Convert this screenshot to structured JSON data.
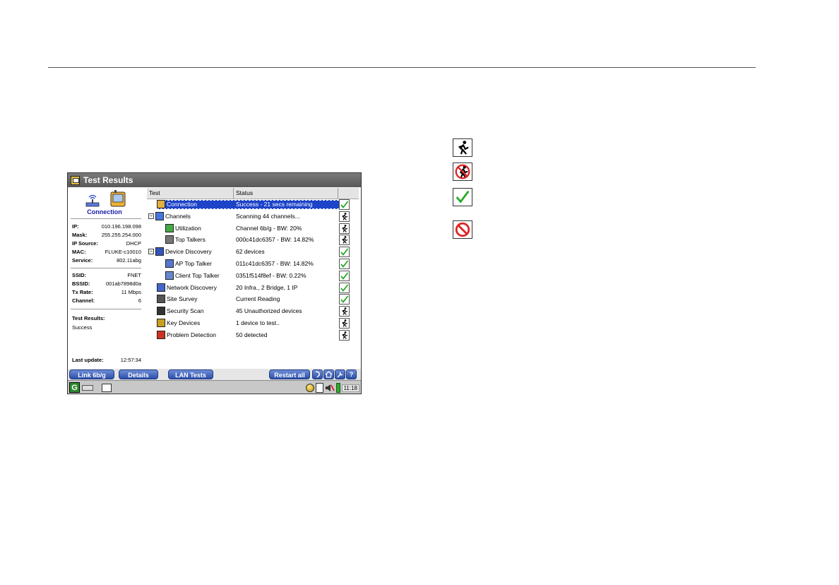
{
  "window": {
    "title": "Test Results"
  },
  "left_panel": {
    "connection_label": "Connection",
    "network_info": [
      {
        "key": "IP:",
        "value": "010.196.198.098"
      },
      {
        "key": "Mask:",
        "value": "255.255.254.000"
      },
      {
        "key": "IP Source:",
        "value": "DHCP"
      },
      {
        "key": "MAC:",
        "value": "FLUKE-c10010"
      },
      {
        "key": "Service:",
        "value": "802.11abg"
      }
    ],
    "wifi_info": [
      {
        "key": "SSID:",
        "value": "FNET"
      },
      {
        "key": "BSSID:",
        "value": "001ab7898d0a"
      },
      {
        "key": "Tx Rate:",
        "value": "11 Mbps"
      },
      {
        "key": "Channel:",
        "value": "6"
      }
    ],
    "test_results_label": "Test Results:",
    "test_results_value": "Success",
    "last_update_label": "Last update:",
    "last_update_value": "12:57:34"
  },
  "table": {
    "col_test": "Test",
    "col_status": "Status",
    "rows": [
      {
        "name": "Connection",
        "status": "Success - 21 secs remaining",
        "result": "check",
        "level": 1,
        "icon": "connection-icon",
        "selected": true
      },
      {
        "name": "Channels",
        "status": "Scanning 44 channels...",
        "result": "run",
        "level": 0,
        "icon": "channels-icon",
        "expander": "−"
      },
      {
        "name": "Utilization",
        "status": "Channel 6b/g - BW: 20%",
        "result": "run",
        "level": 2,
        "icon": "utilization-icon"
      },
      {
        "name": "Top Talkers",
        "status": "000c41dc6357 - BW: 14.82%",
        "result": "run",
        "level": 2,
        "icon": "top-talkers-icon"
      },
      {
        "name": "Device Discovery",
        "status": "62 devices",
        "result": "check",
        "level": 0,
        "icon": "device-discovery-icon",
        "expander": "−"
      },
      {
        "name": "AP Top Talker",
        "status": "011c41dc6357 - BW: 14.82%",
        "result": "check",
        "level": 2,
        "icon": "ap-icon"
      },
      {
        "name": "Client Top Talker",
        "status": "0351f514f8ef - BW: 0.22%",
        "result": "check",
        "level": 2,
        "icon": "client-icon"
      },
      {
        "name": "Network Discovery",
        "status": "20 Infra., 2 Bridge, 1 IP",
        "result": "check",
        "level": 1,
        "icon": "network-discovery-icon"
      },
      {
        "name": "Site Survey",
        "status": "Current Reading",
        "result": "check",
        "level": 1,
        "icon": "site-survey-icon"
      },
      {
        "name": "Security Scan",
        "status": "45 Unauthorized devices",
        "result": "run",
        "level": 1,
        "icon": "security-scan-icon"
      },
      {
        "name": "Key Devices",
        "status": "1 device to test..",
        "result": "run",
        "level": 1,
        "icon": "key-icon"
      },
      {
        "name": "Problem Detection",
        "status": "50 detected",
        "result": "run",
        "level": 1,
        "icon": "problem-detection-icon"
      }
    ]
  },
  "buttons": {
    "link": "Link 6b/g",
    "details": "Details",
    "lan_tests": "LAN Tests",
    "restart_all": "Restart all",
    "help": "?"
  },
  "statusbar": {
    "clock": "11:18"
  },
  "colors": {
    "selection": "#1d43c8",
    "check_green": "#22aa22",
    "stop_red": "#dd2222",
    "button_blue": "#2c4fa8"
  }
}
